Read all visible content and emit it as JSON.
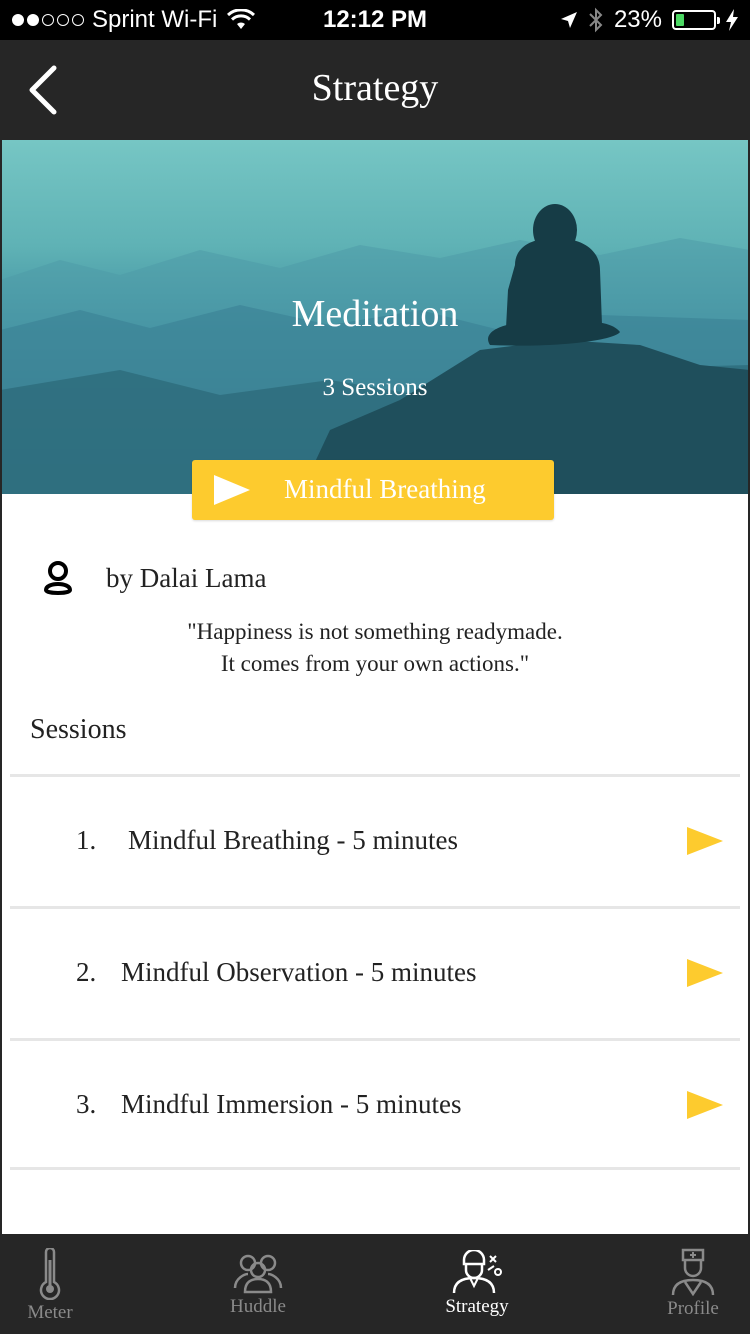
{
  "status_bar": {
    "carrier": "Sprint Wi-Fi",
    "time": "12:12 PM",
    "battery_percent_text": "23%",
    "battery_level": 0.23,
    "signal_bars_filled": 2,
    "signal_bars_total": 5
  },
  "nav": {
    "title": "Strategy",
    "back_icon": "chevron-left-icon"
  },
  "hero": {
    "title": "Meditation",
    "subtitle": "3 Sessions"
  },
  "cta": {
    "label": "Mindful Breathing",
    "icon": "play-icon"
  },
  "author": {
    "icon": "person-icon",
    "name": "by Dalai Lama",
    "quote_line1": "\"Happiness is not something readymade.",
    "quote_line2": "It comes from your own actions.\""
  },
  "sessions": {
    "heading": "Sessions",
    "items": [
      {
        "number": "1.",
        "title": "Mindful Breathing - 5 minutes"
      },
      {
        "number": "2.",
        "title": "Mindful Observation - 5 minutes"
      },
      {
        "number": "3.",
        "title": "Mindful Immersion - 5 minutes"
      }
    ]
  },
  "tabs": [
    {
      "label": "Meter",
      "icon": "thermometer-icon"
    },
    {
      "label": "Huddle",
      "icon": "group-icon"
    },
    {
      "label": "Strategy",
      "icon": "coach-icon",
      "active": true
    },
    {
      "label": "Profile",
      "icon": "nurse-icon"
    }
  ],
  "colors": {
    "accent_yellow": "#fdcb2e",
    "nav_background": "#262626",
    "battery_green": "#4cd964"
  }
}
